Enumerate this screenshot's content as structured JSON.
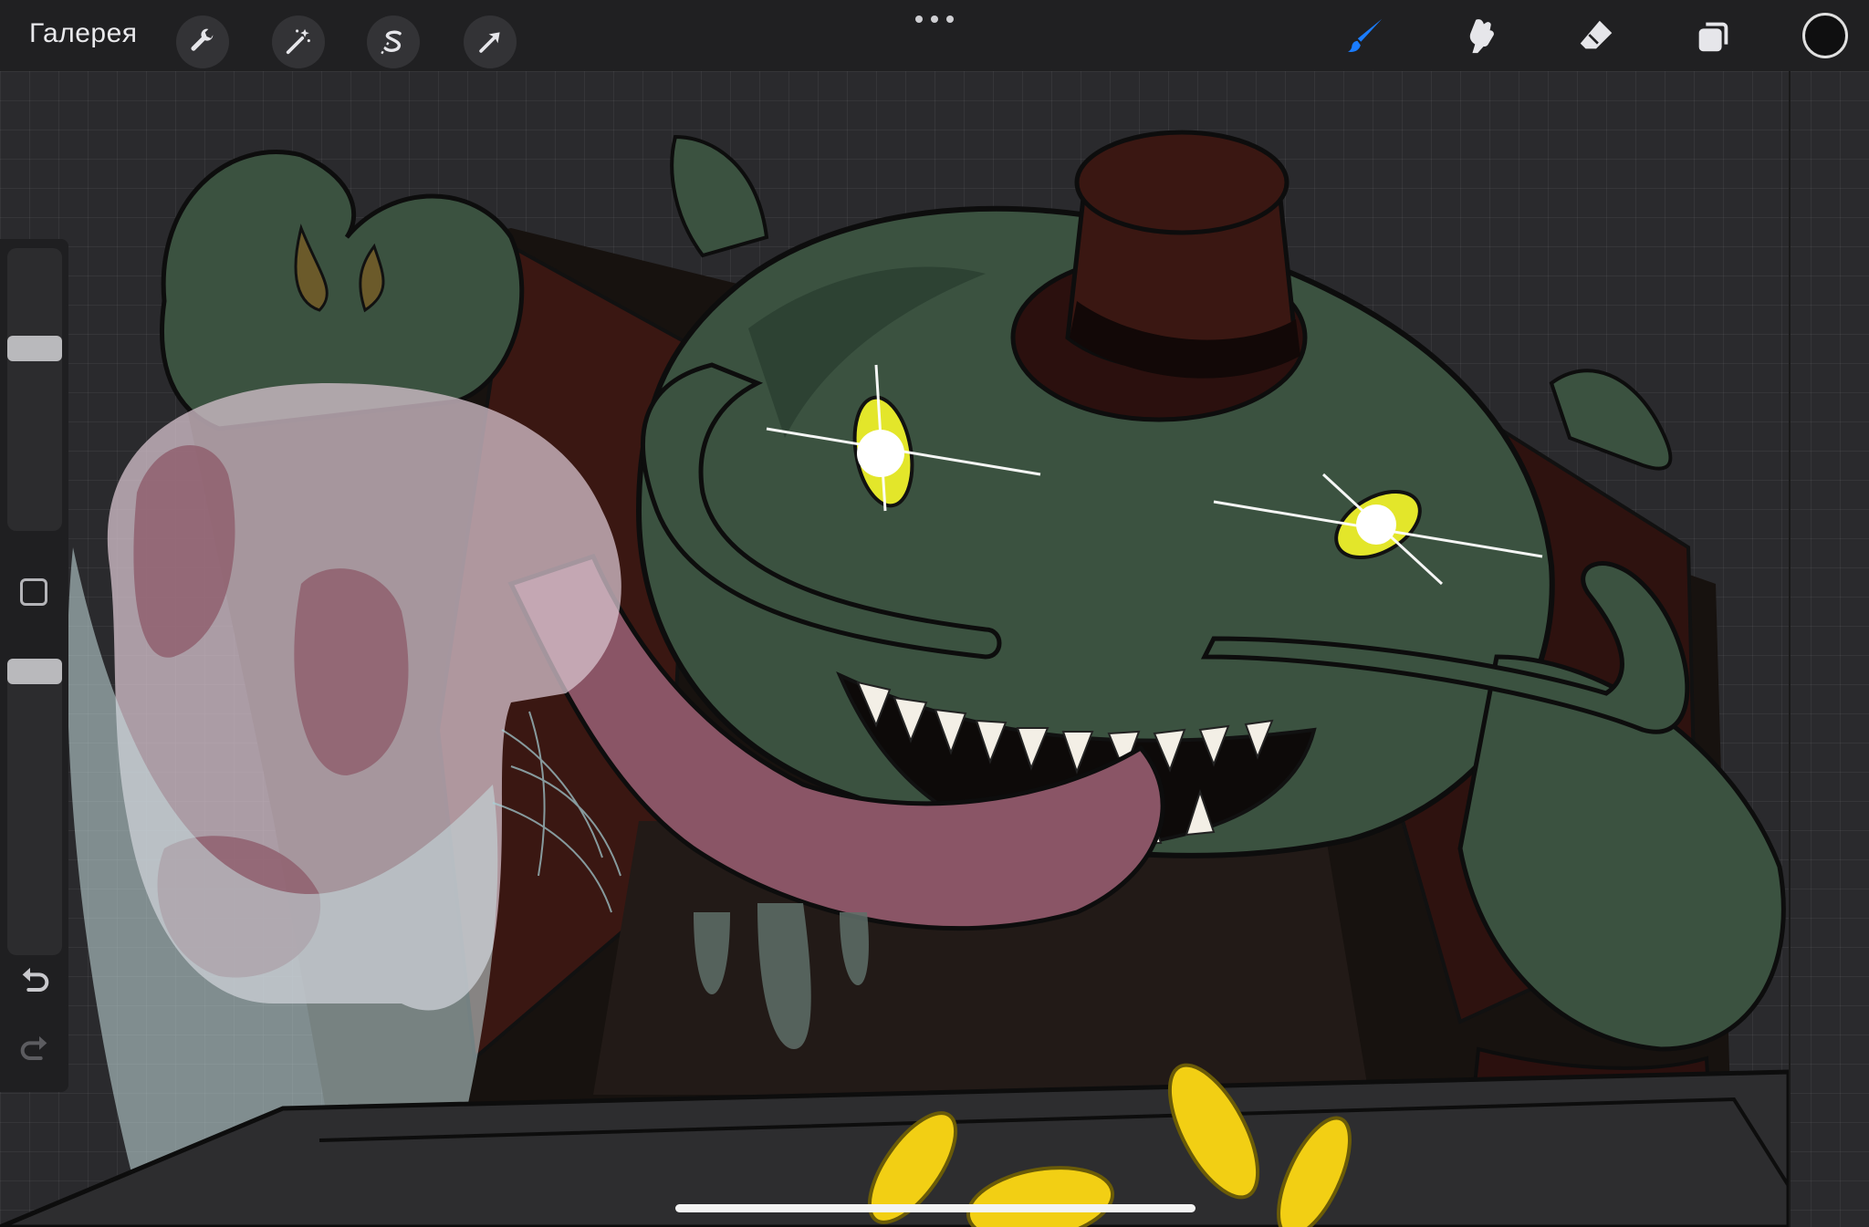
{
  "topbar": {
    "gallery_label": "Галерея",
    "left_tools": [
      "wrench-icon",
      "magic-wand-icon",
      "selection-s-icon",
      "transform-arrow-icon"
    ],
    "more_icon": "ellipsis-icon",
    "right_tools": [
      "brush-icon",
      "smudge-icon",
      "eraser-icon",
      "layers-icon"
    ],
    "active_tool": "brush-icon",
    "active_color": "#0f0f10",
    "accent_color": "#1a7cff"
  },
  "sidebar": {
    "brush_size_level": 0.6,
    "opacity_level": 0.95,
    "modify_icon": "square-icon",
    "undo_icon": "undo-icon",
    "redo_icon": "redo-icon"
  },
  "artwork": {
    "palette": {
      "skin": "#3b5240",
      "skin_dark": "#2a3b2e",
      "coat": "#3a1712",
      "hat": "#2b100e",
      "tongue": "#8a5566",
      "eyes": "#e3e62a",
      "coins": "#f2cf14",
      "spirit": "#b9d8dc"
    }
  }
}
